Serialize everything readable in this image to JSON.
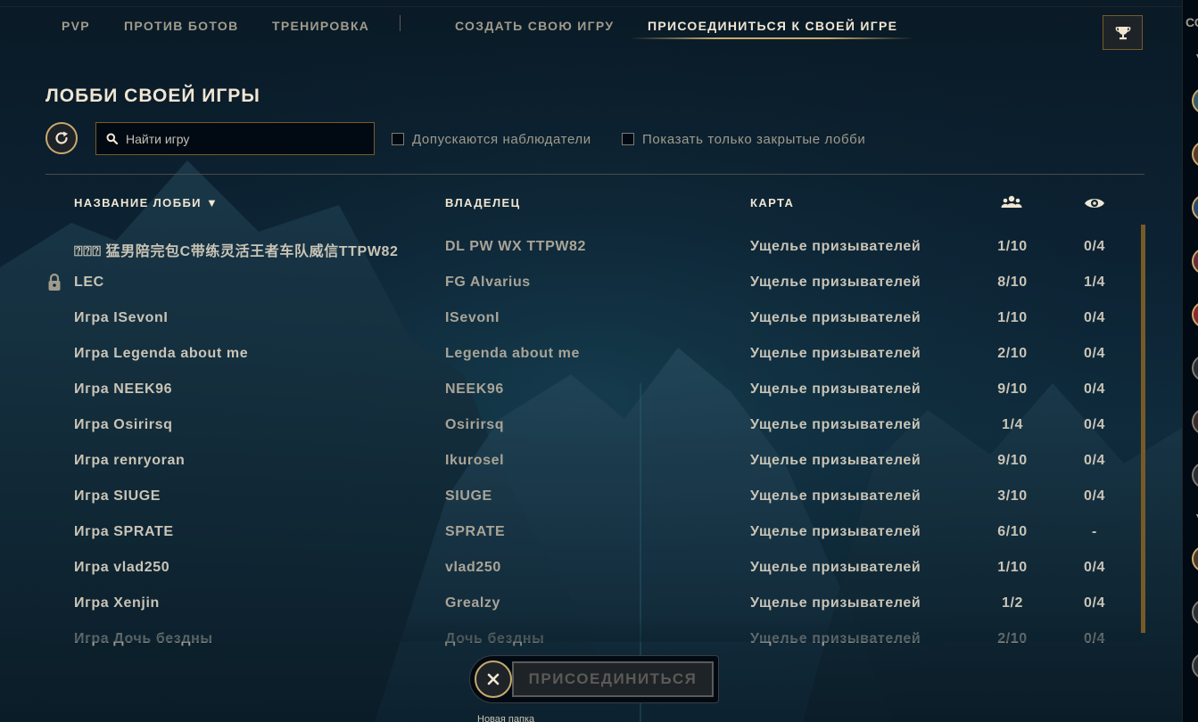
{
  "nav": {
    "items": [
      "PVP",
      "ПРОТИВ БОТОВ",
      "ТРЕНИРОВКА"
    ],
    "create_label": "СОЗДАТЬ СВОЮ ИГРУ",
    "join_label": "ПРИСОЕДИНИТЬСЯ К СВОЕЙ ИГРЕ",
    "trophy_icon": "trophy-icon"
  },
  "page": {
    "title": "ЛОББИ СВОЕЙ ИГРЫ"
  },
  "filters": {
    "search_placeholder": "Найти игру",
    "spectators_label": "Допускаются наблюдатели",
    "private_label": "Показать только закрытые лобби"
  },
  "table": {
    "columns": {
      "name": "НАЗВАНИЕ ЛОББИ ▼",
      "owner": "ВЛАДЕЛЕЦ",
      "map": "КАРТА",
      "players_icon": "players-icon",
      "spectators_icon": "eye-icon"
    },
    "rows": [
      {
        "name": "⍰⍰⍰ 猛男陪完包C带练灵活王者车队威信TTPW82",
        "owner": "DL PW WX TTPW82",
        "map": "Ущелье призывателей",
        "players": "1/10",
        "spectators": "0/4",
        "locked": false
      },
      {
        "name": "LEC",
        "owner": "FG Alvarius",
        "map": "Ущелье призывателей",
        "players": "8/10",
        "spectators": "1/4",
        "locked": true
      },
      {
        "name": "Игра ISevonI",
        "owner": "ISevonI",
        "map": "Ущелье призывателей",
        "players": "1/10",
        "spectators": "0/4",
        "locked": false
      },
      {
        "name": "Игра Legenda about me",
        "owner": "Legenda about me",
        "map": "Ущелье призывателей",
        "players": "2/10",
        "spectators": "0/4",
        "locked": false
      },
      {
        "name": "Игра NEEK96",
        "owner": "NEEK96",
        "map": "Ущелье призывателей",
        "players": "9/10",
        "spectators": "0/4",
        "locked": false
      },
      {
        "name": "Игра Osirirsq",
        "owner": "Osirirsq",
        "map": "Ущелье призывателей",
        "players": "1/4",
        "spectators": "0/4",
        "locked": false
      },
      {
        "name": "Игра renryoran",
        "owner": "Ikurosel",
        "map": "Ущелье призывателей",
        "players": "9/10",
        "spectators": "0/4",
        "locked": false
      },
      {
        "name": "Игра SIUGE",
        "owner": "SIUGE",
        "map": "Ущелье призывателей",
        "players": "3/10",
        "spectators": "0/4",
        "locked": false
      },
      {
        "name": "Игра SPRATE",
        "owner": "SPRATE",
        "map": "Ущелье призывателей",
        "players": "6/10",
        "spectators": "-",
        "locked": false
      },
      {
        "name": "Игра vlad250",
        "owner": "vlad250",
        "map": "Ущелье призывателей",
        "players": "1/10",
        "spectators": "0/4",
        "locked": false
      },
      {
        "name": "Игра Xenjin",
        "owner": "Grealzy",
        "map": "Ущелье призывателей",
        "players": "1/2",
        "spectators": "0/4",
        "locked": false
      },
      {
        "name": "Игра Дочь бездны",
        "owner": "Дочь бездны",
        "map": "Ущелье призывателей",
        "players": "2/10",
        "spectators": "0/4",
        "locked": false
      }
    ]
  },
  "actions": {
    "join_button": "ПРИСОЕДИНИТЬСЯ",
    "cancel_icon": "close-icon"
  },
  "footer": {
    "label": "Новая папка"
  },
  "social": {
    "header": "СО"
  },
  "colors": {
    "gold": "#c8aa6e",
    "gold_dark": "#785a28",
    "text_light": "#f0e6d2",
    "text_muted": "#a09b8c"
  }
}
